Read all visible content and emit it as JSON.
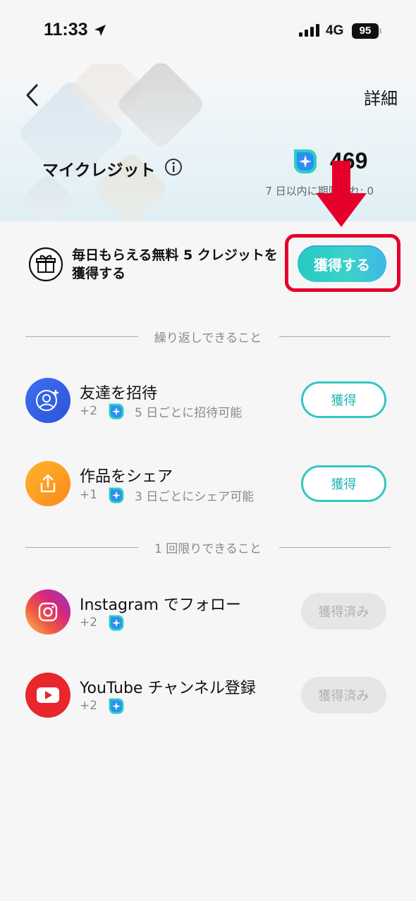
{
  "status_bar": {
    "time": "11:33",
    "network": "4G",
    "battery": "95"
  },
  "header": {
    "detail_link": "詳細",
    "title": "マイクレジット",
    "credit_value": "469",
    "expiry_text": "7 日以内に期限切れ: 0"
  },
  "daily": {
    "text": "毎日もらえる無料 5 クレジットを獲得する",
    "button": "獲得する"
  },
  "sections": {
    "repeatable": "繰り返しできること",
    "once": "1 回限りできること"
  },
  "tasks": [
    {
      "title": "友達を招待",
      "reward": "+2",
      "note": "5 日ごとに招待可能",
      "button": "獲得",
      "state": "available",
      "icon": "add-user-icon"
    },
    {
      "title": "作品をシェア",
      "reward": "+1",
      "note": "3 日ごとにシェア可能",
      "button": "獲得",
      "state": "available",
      "icon": "share-icon"
    },
    {
      "title": "Instagram でフォロー",
      "reward": "+2",
      "note": "",
      "button": "獲得済み",
      "state": "done",
      "icon": "instagram-icon"
    },
    {
      "title": "YouTube チャンネル登録",
      "reward": "+2",
      "note": "",
      "button": "獲得済み",
      "state": "done",
      "icon": "youtube-icon"
    }
  ],
  "colors": {
    "accent": "#33c7c2",
    "highlight": "#e4002b",
    "credit_blue": "#2d8ff0"
  }
}
